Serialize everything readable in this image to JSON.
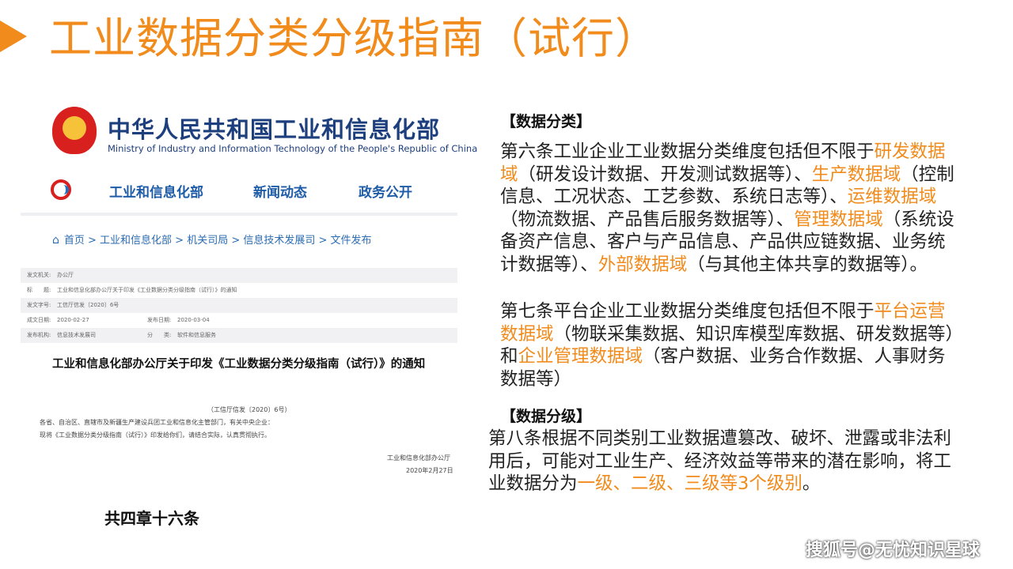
{
  "title": "工业数据分类分级指南（试行）",
  "doc": {
    "ministry_cn": "中华人民共和国工业和信息化部",
    "ministry_en": "Ministry of Industry and Information Technology of the People's Republic of China",
    "nav": [
      "工业和信息化部",
      "新闻动态",
      "政务公开"
    ],
    "breadcrumb": "首页 > 工业和信息化部 > 机关司局 > 信息技术发展司 > 文件发布",
    "meta": {
      "issuer_label": "发文机关:",
      "issuer_value": "办公厅",
      "title_label": "标　　题:",
      "title_value": "工业和信息化部办公厅关于印发《工业数据分类分级指南（试行）》的通知",
      "number_label": "发文字号:",
      "number_value": "工信厅信发〔2020〕6号",
      "created_label": "成文日期:",
      "created_value": "2020-02-27",
      "published_label": "发布日期:",
      "published_value": "2020-03-04",
      "org_label": "发布机构:",
      "org_value": "信息技术发展司",
      "category_label": "分　　类:",
      "category_value": "软件和信息服务"
    },
    "notice_title": "工业和信息化部办公厅关于印发《工业数据分类分级指南（试行）》的通知",
    "doc_number": "（工信厅信发〔2020〕6号）",
    "recipients": "各省、自治区、直辖市及新疆生产建设兵团工业和信息化主管部门，有关中央企业：",
    "body": "现将《工业数据分类分级指南（试行）》印发给你们，请结合实际，认真贯彻执行。",
    "signature": "工业和信息化部办公厅",
    "date": "2020年2月27日",
    "chapters": "共四章十六条"
  },
  "classification": {
    "heading": "【数据分类】",
    "article6": [
      {
        "t": "第六条工业企业工业数据分类维度包括但不限于",
        "hl": false
      },
      {
        "t": "研发数据域",
        "hl": true
      },
      {
        "t": "（研发设计数据、开发测试数据等）、",
        "hl": false
      },
      {
        "t": "生产数据域",
        "hl": true
      },
      {
        "t": "（控制信息、工况状态、工艺参数、系统日志等）、",
        "hl": false
      },
      {
        "t": "运维数据域",
        "hl": true
      },
      {
        "t": "（物流数据、产品售后服务数据等）、",
        "hl": false
      },
      {
        "t": "管理数据域",
        "hl": true
      },
      {
        "t": "（系统设备资产信息、客户与产品信息、产品供应链数据、业务统计数据等）、",
        "hl": false
      },
      {
        "t": "外部数据域",
        "hl": true
      },
      {
        "t": "（与其他主体共享的数据等）。",
        "hl": false
      }
    ],
    "article7": [
      {
        "t": "第七条平台企业工业数据分类维度包括但不限于",
        "hl": false
      },
      {
        "t": "平台运营数据域",
        "hl": true
      },
      {
        "t": "（物联采集数据、知识库模型库数据、研发数据等）和",
        "hl": false
      },
      {
        "t": "企业管理数据域",
        "hl": true
      },
      {
        "t": "（客户数据、业务合作数据、人事财务数据等）",
        "hl": false
      }
    ]
  },
  "grading": {
    "heading": "【数据分级】",
    "article8": [
      {
        "t": "第八条根据不同类别工业数据遭篡改、破坏、泄露或非法利用后，可能对工业生产、经济效益等带来的潜在影响，将工业数据分为",
        "hl": false
      },
      {
        "t": "一级、二级、三级等3个级别",
        "hl": true
      },
      {
        "t": "。",
        "hl": false
      }
    ]
  },
  "watermark": "搜狐号@无忧知识星球",
  "colors": {
    "accent": "#F08B1C",
    "ministry_blue": "#1E3F7E",
    "link_blue": "#2B6CB3"
  }
}
